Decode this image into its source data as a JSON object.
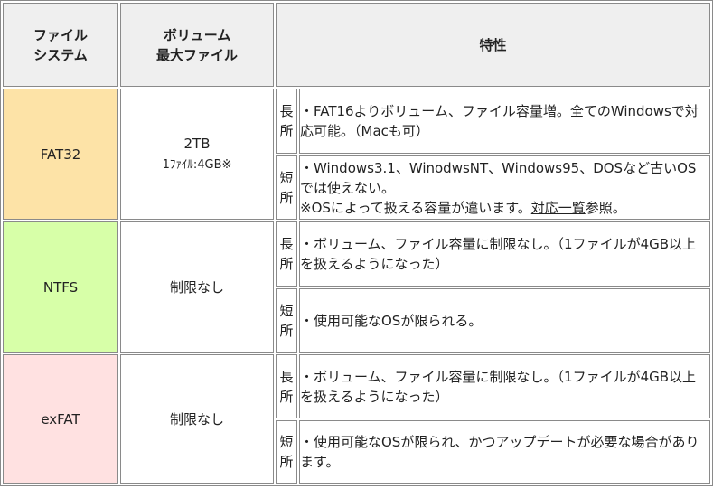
{
  "header": {
    "col1_line1": "ファイル",
    "col1_line2": "システム",
    "col2_line1": "ボリューム",
    "col2_line2": "最大ファイル",
    "col3": "特性"
  },
  "rows": [
    {
      "name": "FAT32",
      "volume": "2TB",
      "file_size": "1ﾌｧｲﾙ:4GB※",
      "color": "#fde3a7",
      "merit_label_1": "長",
      "merit_label_2": "所",
      "merit_text": "・FAT16よりボリューム、ファイル容量増。全てのWindowsで対応可能。（Macも可）",
      "demerit_label_1": "短",
      "demerit_label_2": "所",
      "demerit_text_a": "・Windows3.1、WinodwsNT、Windows95、DOSなど古いOSでは使えない。",
      "demerit_text_b": "※OSによって扱える容量が違います。",
      "demerit_link": "対応一覧",
      "demerit_text_c": "参照。"
    },
    {
      "name": "NTFS",
      "volume": "制限なし",
      "color": "#d7ffa8",
      "merit_label_1": "長",
      "merit_label_2": "所",
      "merit_text": "・ボリューム、ファイル容量に制限なし。（1ファイルが4GB以上を扱えるようになった）",
      "demerit_label_1": "短",
      "demerit_label_2": "所",
      "demerit_text": "・使用可能なOSが限られる。"
    },
    {
      "name": "exFAT",
      "volume": "制限なし",
      "color": "#ffe1e1",
      "merit_label_1": "長",
      "merit_label_2": "所",
      "merit_text": "・ボリューム、ファイル容量に制限なし。（1ファイルが4GB以上を扱えるようになった）",
      "demerit_label_1": "短",
      "demerit_label_2": "所",
      "demerit_text": "・使用可能なOSが限られ、かつアップデートが必要な場合があります。"
    }
  ]
}
